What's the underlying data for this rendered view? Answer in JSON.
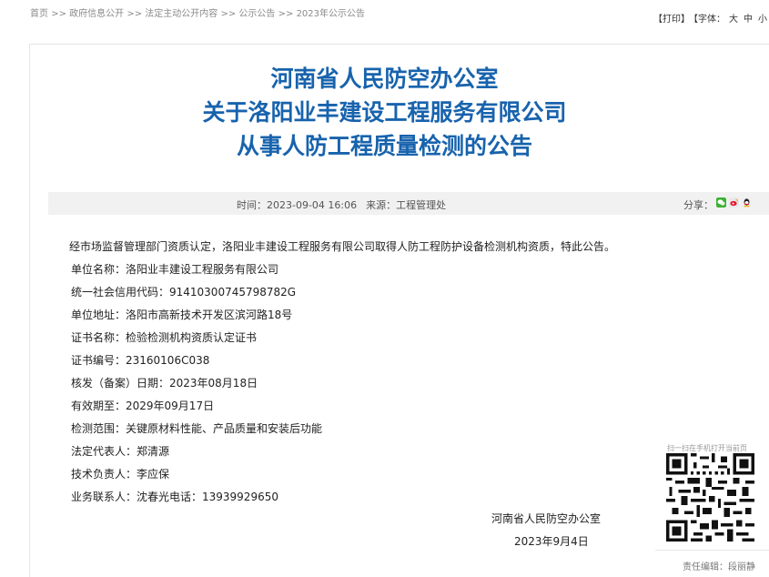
{
  "breadcrumb": {
    "items": [
      "首页",
      "政府信息公开",
      "法定主动公开内容",
      "公示公告",
      "2023年公示公告"
    ],
    "separator": ">>"
  },
  "tools": {
    "print": "【打印】",
    "font_label": "【字体：",
    "font_large": "大",
    "font_medium": "中",
    "font_small": "小"
  },
  "article": {
    "title_lines": [
      "河南省人民防空办公室",
      "关于洛阳业丰建设工程服务有限公司",
      "从事人防工程质量检测的公告"
    ],
    "meta": {
      "time_label": "时间：",
      "time": "2023-09-04 16:06",
      "source_label": "来源：",
      "source": "工程管理处"
    },
    "share_label": "分享：",
    "body": [
      "经市场监督管理部门资质认定，洛阳业丰建设工程服务有限公司取得人防工程防护设备检测机构资质，特此公告。",
      "单位名称：洛阳业丰建设工程服务有限公司",
      "统一社会信用代码：91410300745798782G",
      "单位地址：洛阳市高新技术开发区滨河路18号",
      "证书名称：检验检测机构资质认定证书",
      "证书编号：23160106C038",
      "核发（备案）日期：2023年08月18日",
      "有效期至：2029年09月17日",
      "检测范围：关键原材料性能、产品质量和安装后功能",
      "法定代表人：郑清源",
      "技术负责人：李应保",
      "业务联系人：沈春光电话：13939929650"
    ],
    "signature": "河南省人民防空办公室",
    "date": "2023年9月4日",
    "qr_caption": "扫一扫在手机打开当前页",
    "editor": "责任编辑：段丽静"
  },
  "colors": {
    "title": "#1863ad",
    "meta_bg": "#f1f1f1"
  },
  "icons": [
    "wechat-share-icon",
    "weibo-share-icon",
    "qq-share-icon",
    "qr-code-icon"
  ]
}
